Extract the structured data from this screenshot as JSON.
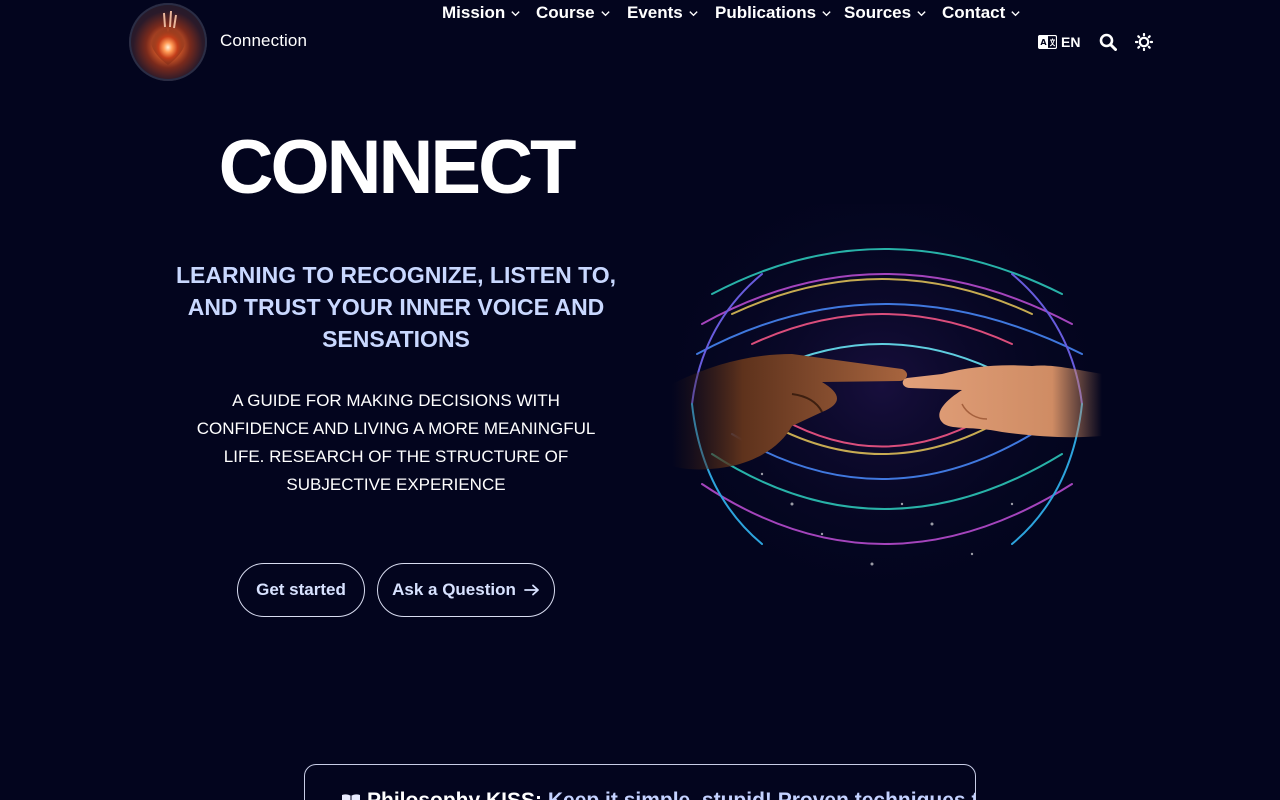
{
  "header": {
    "brand": "Connection",
    "nav": [
      {
        "label": "Mission"
      },
      {
        "label": "Course"
      },
      {
        "label": "Events"
      },
      {
        "label": "Publications"
      },
      {
        "label": "Sources"
      },
      {
        "label": "Contact"
      }
    ],
    "language": "EN",
    "icons": {
      "logo": "heart-logo",
      "language": "language-icon",
      "search": "search-icon",
      "theme": "theme-toggle-icon"
    }
  },
  "hero": {
    "title": "CONNECT",
    "subtitle": "LEARNING TO RECOGNIZE, LISTEN TO, AND TRUST YOUR INNER VOICE AND SENSATIONS",
    "description": "A GUIDE FOR MAKING DECISIONS WITH CONFIDENCE AND LIVING A MORE MEANINGFUL LIFE. RESEARCH OF THE STRUCTURE OF SUBJECTIVE EXPERIENCE",
    "primary_button": "Get started",
    "secondary_button": "Ask a Question"
  },
  "card": {
    "lead": "Philosophy KISS:",
    "text": "Keep it simple, stupid! Proven techniques to"
  },
  "colors": {
    "background": "#03051e",
    "accent_text": "#c9d8ff"
  }
}
